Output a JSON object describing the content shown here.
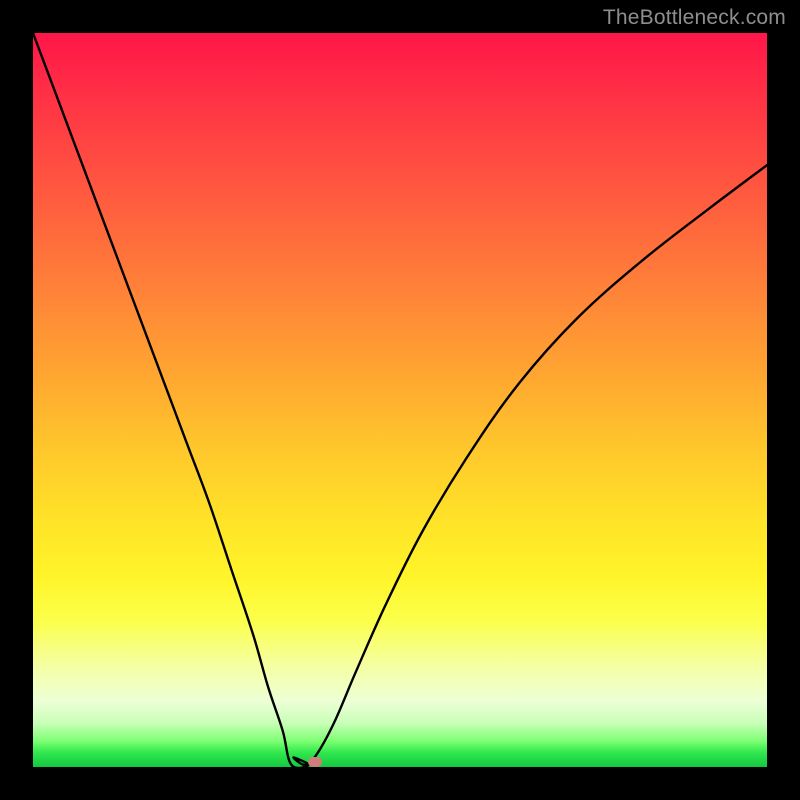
{
  "attribution": "TheBottleneck.com",
  "colors": {
    "frame": "#000000",
    "curve": "#000000",
    "marker": "#cf7e7b",
    "gradient_top": "#ff1648",
    "gradient_bottom": "#14c83f"
  },
  "chart_data": {
    "type": "line",
    "title": "",
    "xlabel": "",
    "ylabel": "",
    "xlim": [
      0,
      100
    ],
    "ylim": [
      0,
      100
    ],
    "grid": false,
    "legend": false,
    "notes": "Axes are unlabeled in the source image; values are read in percent-of-plot-area coordinates (0 = left/bottom edge, 100 = right/top edge). The curve is a single black V-like trace whose minimum touches the bottom edge near x≈37.",
    "series": [
      {
        "name": "curve",
        "x": [
          0,
          3,
          6,
          9,
          12,
          15,
          18,
          21,
          24,
          27,
          30,
          32,
          34,
          35.5,
          37,
          38.5,
          41,
          44,
          48,
          53,
          59,
          66,
          74,
          83,
          92,
          100
        ],
        "y": [
          100,
          92,
          84,
          76,
          68,
          60,
          52,
          44,
          36,
          27,
          18,
          11,
          5,
          1.3,
          0.3,
          1.5,
          6,
          13,
          22,
          32,
          42,
          52,
          61,
          69,
          76,
          82
        ]
      }
    ],
    "plateau": {
      "note": "Small flat segment at the trough between x≈35.2 and x≈37.6 at y≈0.3",
      "x_start": 35.2,
      "x_end": 37.6,
      "y": 0.3
    },
    "marker": {
      "x": 38.4,
      "y": 0.7
    }
  }
}
